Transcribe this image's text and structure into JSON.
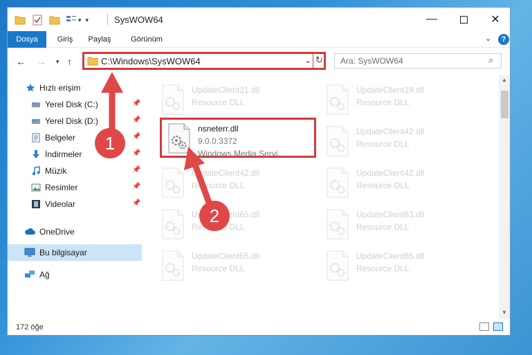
{
  "window": {
    "title": "SysWOW64"
  },
  "ribbon": {
    "tabs": [
      "Dosya",
      "Giriş",
      "Paylaş",
      "Görünüm"
    ]
  },
  "navbar": {
    "address": "C:\\Windows\\SysWOW64",
    "search_placeholder": "Ara: SysWOW64"
  },
  "sidebar": {
    "items": [
      {
        "label": "Hızlı erişim",
        "icon": "star-icon"
      },
      {
        "label": "Yerel Disk (C:)",
        "icon": "drive-icon"
      },
      {
        "label": "Yerel Disk (D:)",
        "icon": "drive-icon"
      },
      {
        "label": "Belgeler",
        "icon": "documents-icon"
      },
      {
        "label": "İndirmeler",
        "icon": "download-icon"
      },
      {
        "label": "Müzik",
        "icon": "music-icon"
      },
      {
        "label": "Resimler",
        "icon": "pictures-icon"
      },
      {
        "label": "Videolar",
        "icon": "videos-icon"
      },
      {
        "label": "OneDrive",
        "icon": "cloud-icon"
      },
      {
        "label": "Bu bilgisayar",
        "icon": "computer-icon"
      },
      {
        "label": "Ağ",
        "icon": "network-icon"
      }
    ]
  },
  "files": {
    "selected": {
      "name": "nsneterr.dll",
      "version": "9.0.0.3372",
      "description": "Windows Media Servi..."
    },
    "background": [
      {
        "name": "UpdateClient21.dll",
        "type": "Resource DLL"
      },
      {
        "name": "UpdateClient19.dll",
        "type": "Resource DLL"
      },
      {
        "name": "UpdateClient42.dll",
        "type": "Resource DLL"
      },
      {
        "name": "UpdateClient42.dll",
        "type": "Resource DLL"
      },
      {
        "name": "UpdateClient42.dll",
        "type": "Resource DLL"
      },
      {
        "name": "UpdateClient65.dll",
        "type": "Resource DLL"
      },
      {
        "name": "UpdateClient63.dll",
        "type": "Resource DLL"
      },
      {
        "name": "UpdateClient65.dll",
        "type": "Resource DLL"
      },
      {
        "name": "UpdateClient65.dll",
        "type": "Resource DLL"
      }
    ]
  },
  "status": {
    "item_count": "172 öğe"
  },
  "annotations": {
    "badge_1": "1",
    "badge_2": "2"
  },
  "colors": {
    "accent": "#1979ca",
    "highlight": "#d23a3a"
  }
}
